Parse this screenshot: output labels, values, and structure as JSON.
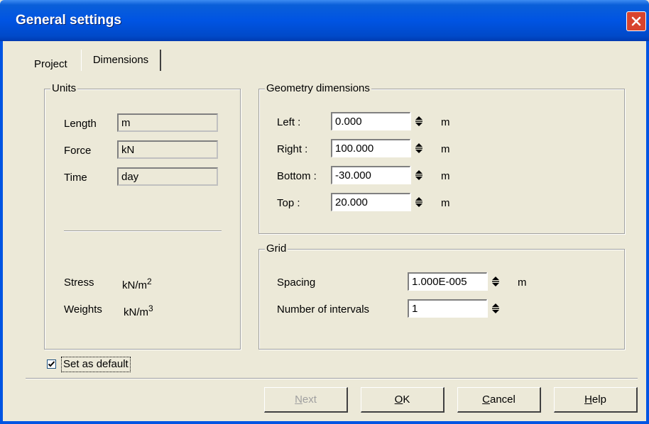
{
  "window": {
    "title": "General settings"
  },
  "tabs": [
    {
      "label": "Project"
    },
    {
      "label": "Dimensions"
    }
  ],
  "units": {
    "group_title": "Units",
    "length_label": "Length",
    "length_value": "m",
    "force_label": "Force",
    "force_value": "kN",
    "time_label": "Time",
    "time_value": "day",
    "stress_label": "Stress",
    "stress_unit": "kN/m",
    "stress_exp": "2",
    "weights_label": "Weights",
    "weights_unit": "kN/m",
    "weights_exp": "3"
  },
  "geometry": {
    "group_title": "Geometry dimensions",
    "rows": [
      {
        "label": "Left :",
        "value": "0.000",
        "unit": "m"
      },
      {
        "label": "Right :",
        "value": "100.000",
        "unit": "m"
      },
      {
        "label": "Bottom :",
        "value": "-30.000",
        "unit": "m"
      },
      {
        "label": "Top :",
        "value": "20.000",
        "unit": "m"
      }
    ]
  },
  "grid": {
    "group_title": "Grid",
    "spacing_label": "Spacing",
    "spacing_value": "1.000E-005",
    "spacing_unit": "m",
    "intervals_label": "Number of intervals",
    "intervals_value": "1"
  },
  "default_checkbox": {
    "label": "Set as default",
    "checked": true
  },
  "buttons": {
    "next_accel": "N",
    "next_rest": "ext",
    "ok_accel": "O",
    "ok_rest": "K",
    "cancel_accel": "C",
    "cancel_rest": "ancel",
    "help_accel": "H",
    "help_rest": "elp"
  },
  "colors": {
    "titlebar": "#0054e3",
    "dialog_bg": "#ece9d8",
    "close_button": "#d8442e"
  }
}
